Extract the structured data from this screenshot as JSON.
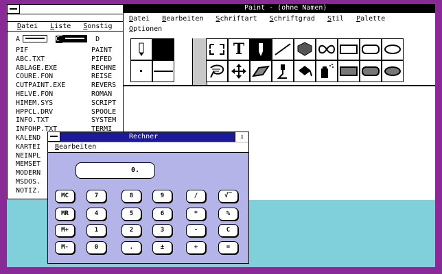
{
  "file_manager": {
    "menu": [
      "Datei",
      "Liste",
      "Sonstig"
    ],
    "drives": [
      "A",
      "C",
      "D"
    ],
    "selected_drive": "C",
    "files_col1": [
      "PIF",
      "ABC.TXT",
      "ABLAGE.EXE",
      "COURE.FON",
      "CUTPAINT.EXE",
      "HELVE.FON",
      "HIMEM.SYS",
      "HPPCL.DRV",
      "INFO.TXT",
      "INFOHP.TXT",
      "KALEND",
      "KARTEI",
      "NEINPL",
      "MEMSET",
      "MODERN",
      "MSDOS.",
      "NOTIZ."
    ],
    "files_col2": [
      "PAINT",
      "PIFED",
      "RECHNE",
      "REISE",
      "REVERS",
      "ROMAN",
      "SCRIPT",
      "SPOOLE",
      "SYSTEM",
      "TERMI"
    ]
  },
  "paint": {
    "title": "Paint - (ohne Namen)",
    "menu_row1": [
      "Datei",
      "Bearbeiten",
      "Schriftart",
      "Schriftgrad",
      "Stil",
      "Palette"
    ],
    "menu_row2": [
      "Optionen"
    ],
    "tools": [
      "pencil-icon",
      "fill-color-swatch",
      "selection-icon",
      "text-icon",
      "brush-icon",
      "line-icon",
      "spray-fill-icon",
      "curve-icon",
      "rectangle-icon",
      "rounded-rect-icon",
      "dot-width-icon",
      "line-width-icon",
      "lasso-icon",
      "move-icon",
      "eraser-icon",
      "paint-roller-icon",
      "fill-bucket-icon",
      "spray-can-icon",
      "filled-rectangle-icon",
      "filled-rounded-rect-icon"
    ]
  },
  "calculator": {
    "title": "Rechner",
    "menu": [
      "Bearbeiten"
    ],
    "display": "0.",
    "keys": [
      [
        "MC",
        "7",
        "8",
        "9",
        "/",
        "√‾"
      ],
      [
        "MR",
        "4",
        "5",
        "6",
        "*",
        "%"
      ],
      [
        "M+",
        "1",
        "2",
        "3",
        "-",
        "C"
      ],
      [
        "M-",
        "0",
        ".",
        "±",
        "+",
        "="
      ]
    ]
  }
}
